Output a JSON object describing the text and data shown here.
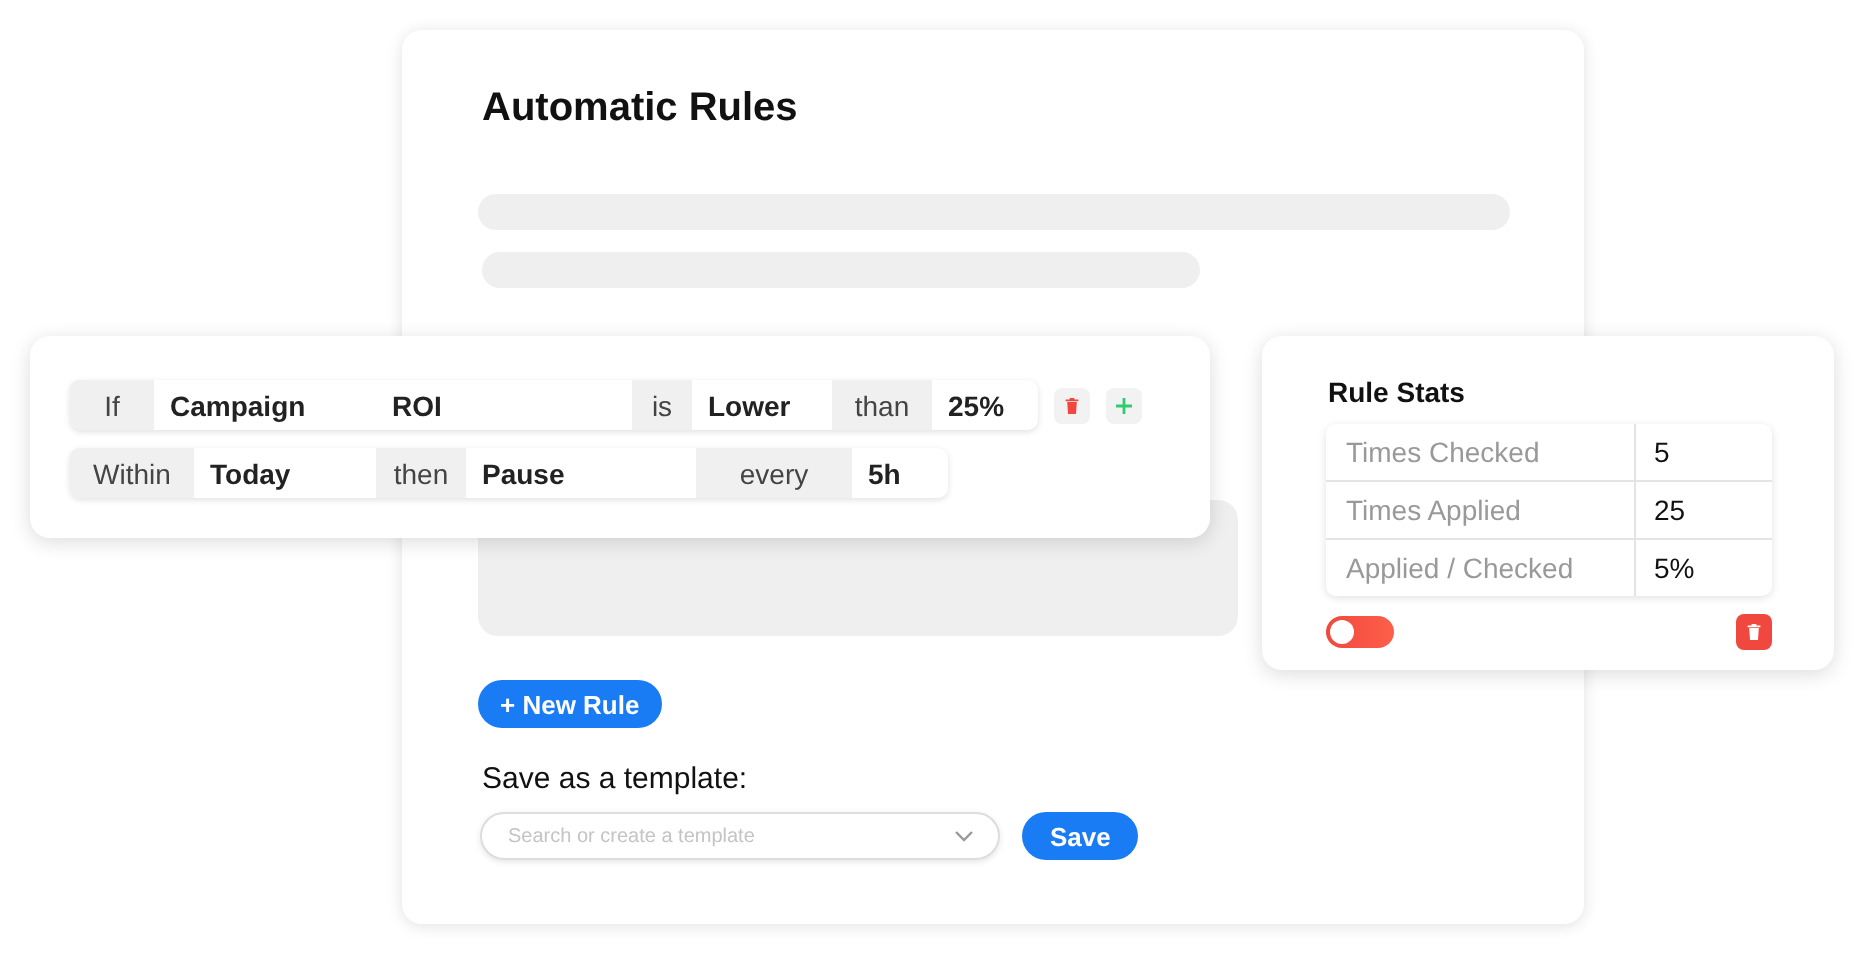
{
  "panel": {
    "title": "Automatic Rules",
    "new_rule_button": "+ New Rule",
    "template_label": "Save as a template:",
    "template_field": {
      "placeholder": "Search or create a template"
    },
    "save_button": "Save"
  },
  "rule": {
    "rows": [
      {
        "segments": [
          {
            "text": "If",
            "kind": "label"
          },
          {
            "text": "Campaign",
            "kind": "value"
          },
          {
            "text": "ROI",
            "kind": "value"
          },
          {
            "text": "is",
            "kind": "label"
          },
          {
            "text": "Lower",
            "kind": "value"
          },
          {
            "text": "than",
            "kind": "label"
          },
          {
            "text": "25%",
            "kind": "value"
          }
        ],
        "actions": [
          {
            "kind": "delete"
          },
          {
            "kind": "add"
          }
        ]
      },
      {
        "segments": [
          {
            "text": "Within",
            "kind": "label"
          },
          {
            "text": "Today",
            "kind": "value"
          },
          {
            "text": "then",
            "kind": "label"
          },
          {
            "text": "Pause",
            "kind": "value"
          },
          {
            "text": "every",
            "kind": "label"
          },
          {
            "text": "5h",
            "kind": "value"
          }
        ]
      }
    ]
  },
  "stats": {
    "title": "Rule Stats",
    "rows": [
      {
        "label": "Times Checked",
        "value": "5"
      },
      {
        "label": "Times Applied",
        "value": "25"
      },
      {
        "label": "Applied / Checked",
        "value": "5%"
      }
    ],
    "toggle": {
      "on": false
    }
  }
}
